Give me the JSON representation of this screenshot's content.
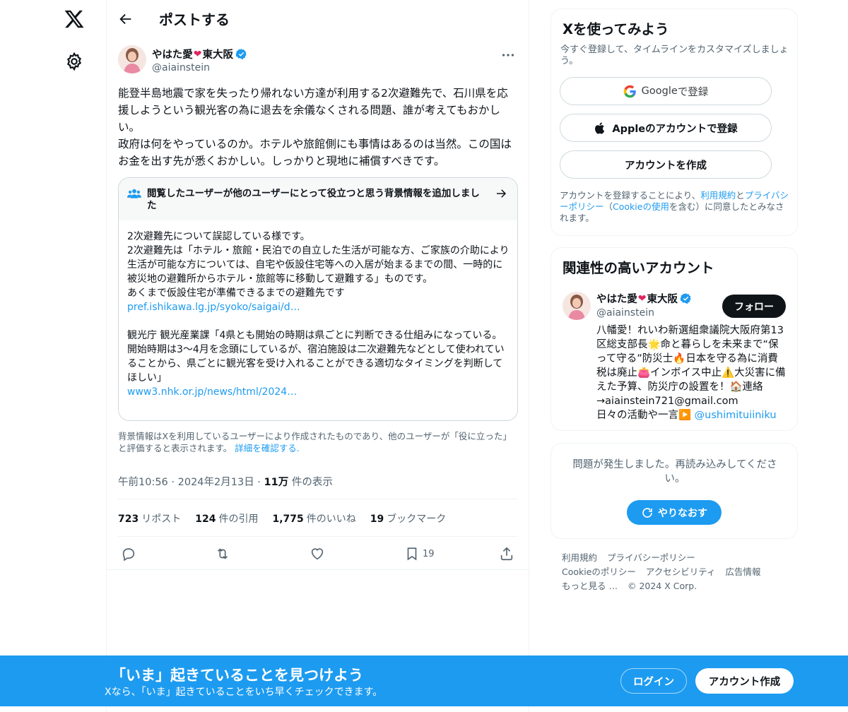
{
  "header": {
    "title": "ポストする"
  },
  "tweet": {
    "author_name_pre": "やはた愛",
    "author_name_post": "東大阪",
    "handle": "@aiainstein",
    "text": "能登半島地震で家を失ったり帰れない方達が利用する2次避難先で、石川県を応援しようという観光客の為に退去を余儀なくされる問題、誰が考えてもおかしい。\n政府は何をやっているのか。ホテルや旅館側にも事情はあるのは当然。この国はお金を出す先が悉くおかしい。しっかりと現地に補償すべきです。",
    "timestamp": "午前10:56 · 2024年2月13日",
    "views_count": "11万",
    "views_label": "件の表示"
  },
  "note": {
    "title": "閲覧したユーザーが他のユーザーにとって役立つと思う背景情報を追加しました",
    "body1": "2次避難先について誤認している様です。\n2次避難先は「ホテル・旅館・民泊での自立した生活が可能な方、ご家族の介助により生活が可能な方については、自宅や仮設住宅等への入居が始まるまでの間、一時的に被災地の避難所からホテル・旅館等に移動して避難する」ものです。\nあくまで仮設住宅が準備できるまでの避難先です",
    "link1": "pref.ishikawa.lg.jp/syoko/saigai/d…",
    "body2": "観光庁 観光産業課「4県とも開始の時期は県ごとに判断できる仕組みになっている。開始時期は3〜4月を念頭にしているが、宿泊施設は二次避難先などとして使われていることから、県ごとに観光客を受け入れることができる適切なタイミングを判断してほしい」",
    "link2": "www3.nhk.or.jp/news/html/2024…",
    "footer_text": "背景情報はXを利用しているユーザーにより作成されたものであり、他のユーザーが「役に立った」と評価すると表示されます。",
    "footer_link": "詳細を確認する."
  },
  "stats": [
    {
      "count": "723",
      "label": "リポスト"
    },
    {
      "count": "124",
      "label": "件の引用"
    },
    {
      "count": "1,775",
      "label": "件のいいね"
    },
    {
      "count": "19",
      "label": "ブックマーク"
    }
  ],
  "actions": {
    "bookmark_count": "19"
  },
  "signup_card": {
    "title": "Xを使ってみよう",
    "subtitle": "今すぐ登録して、タイムラインをカスタマイズしましょう。",
    "google_brand": "Google",
    "google_suffix": " で登録",
    "apple": "Appleのアカウントで登録",
    "create": "アカウントを作成",
    "terms_pre": "アカウントを登録することにより、",
    "terms_link1": "利用規約",
    "terms_mid1": "と",
    "terms_link2": "プライバシーポリシー",
    "terms_mid2": "（",
    "terms_link3": "Cookieの使用",
    "terms_post": "を含む）に同意したとみなされます。"
  },
  "related": {
    "title": "関連性の高いアカウント",
    "name_pre": "やはた愛",
    "name_post": "東大阪",
    "handle": "@aiainstein",
    "follow": "フォロー",
    "bio": "八幡愛！れいわ新選組衆議院大阪府第13区総支部長🌟命と暮らしを未来まで“保って守る”防災士🔥日本を守る為に消費税は廃止👛インボイス中止⚠️大災害に備えた予算、防災庁の設置を！🏠連絡→aiainstein721@gmail.com\n日々の活動や一言▶️ ",
    "mention": "@ushimituiiniku"
  },
  "error_card": {
    "message": "問題が発生しました。再読み込みしてください。",
    "retry": "やりなおす"
  },
  "footer": {
    "line1": [
      "利用規約",
      "プライバシーポリシー"
    ],
    "line2": [
      "Cookieのポリシー",
      "アクセシビリティ",
      "広告情報"
    ],
    "more": "もっと見る …",
    "copyright": "© 2024 X Corp."
  },
  "bottom_bar": {
    "title": "「いま」起きていることを見つけよう",
    "subtitle": "Xなら、「いま」起きていることをいち早くチェックできます。",
    "login": "ログイン",
    "signup": "アカウント作成"
  },
  "colors": {
    "accent": "#1d9bf0",
    "text": "#0f1419",
    "muted": "#536471",
    "heart": "#e0245e"
  }
}
